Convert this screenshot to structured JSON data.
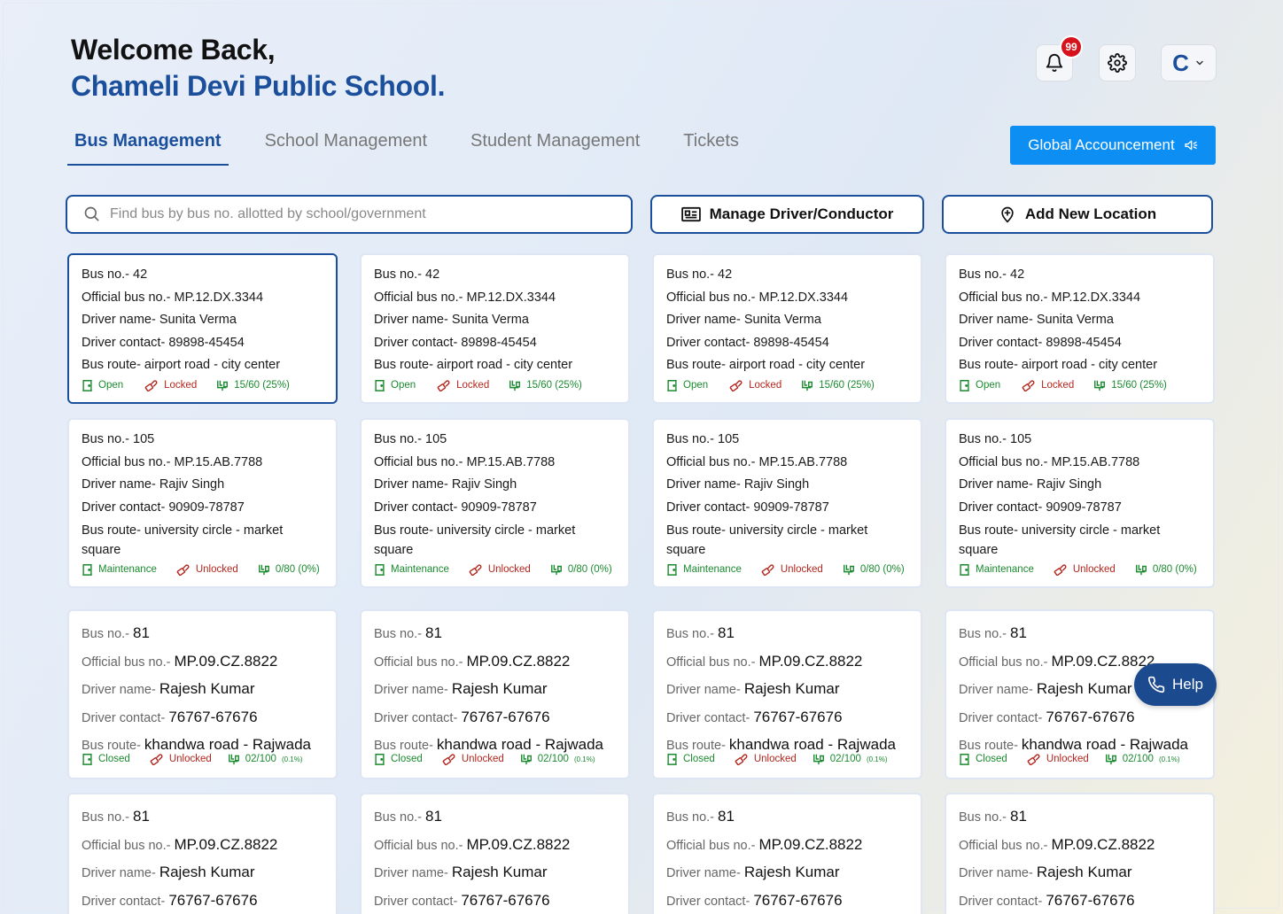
{
  "header": {
    "welcome": "Welcome Back,",
    "school_name": "Chameli Devi Public School.",
    "notification_count": "99",
    "avatar_letter": "C"
  },
  "tabs": [
    {
      "label": "Bus Management",
      "active": true
    },
    {
      "label": "School Management",
      "active": false
    },
    {
      "label": "Student Management",
      "active": false
    },
    {
      "label": "Tickets",
      "active": false
    }
  ],
  "toolbar": {
    "announcement_label": "Global Accouncement",
    "search_placeholder": "Find bus by bus no. allotted by school/government",
    "search_value": "",
    "manage_driver_label": "Manage Driver/Conductor",
    "add_location_label": "Add New Location",
    "help_label": "Help"
  },
  "labels": {
    "bus_no": "Bus no.- ",
    "official": "Official bus no.- ",
    "driver_name": "Driver name- ",
    "driver_contact": "Driver contact- ",
    "route": "Bus route- "
  },
  "bus_groups": [
    {
      "bus_no": "42",
      "official": "MP.12.DX.3344",
      "driver_name": "Sunita Verma",
      "contact": "89898-45454",
      "route": "airport road - city center",
      "status": "Open",
      "lock": "Locked",
      "capacity": "15/60 (25%)",
      "capacity_pct": ""
    },
    {
      "bus_no": "105",
      "official": "MP.15.AB.7788",
      "driver_name": "Rajiv Singh",
      "contact": "90909-78787",
      "route": "university circle - market square",
      "status": "Maintenance",
      "lock": "Unlocked",
      "capacity": "0/80 (0%)",
      "capacity_pct": ""
    },
    {
      "bus_no": "81",
      "official": "MP.09.CZ.8822",
      "driver_name": "Rajesh Kumar",
      "contact": "76767-67676",
      "route": "khandwa road - Rajwada",
      "status": "Closed",
      "lock": "Unlocked",
      "capacity": "02/100",
      "capacity_pct": "(0.1%)"
    },
    {
      "bus_no": "81",
      "official": "MP.09.CZ.8822",
      "driver_name": "Rajesh Kumar",
      "contact": "76767-67676",
      "route": "khandwa road - Rajwada",
      "status": "Closed",
      "lock": "Unlocked",
      "capacity": "02/100",
      "capacity_pct": "(0.1%)"
    }
  ],
  "colors": {
    "primary": "#1b4f9c",
    "accent": "#0c8ef2",
    "badge": "#d6121c",
    "green": "#1a8a2f",
    "red": "#b3261e"
  }
}
